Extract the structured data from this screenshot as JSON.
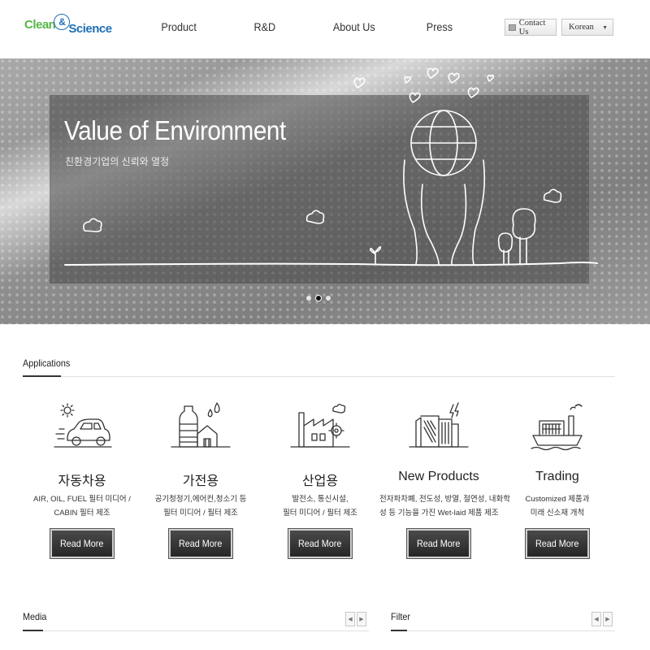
{
  "header": {
    "logo": {
      "part1": "Clean",
      "amp": "&",
      "part2": "Science"
    },
    "nav": [
      {
        "label": "Product"
      },
      {
        "label": "R&D"
      },
      {
        "label": "About Us"
      },
      {
        "label": "Press"
      }
    ],
    "contact_label": "Contact Us",
    "language": "Korean"
  },
  "hero": {
    "title": "Value of Environment",
    "subtitle": "친환경기업의 신뢰와 열정",
    "slides": 3,
    "active_slide": 2
  },
  "applications": {
    "title": "Applications",
    "items": [
      {
        "title": "자동차용",
        "desc1": "AIR, OIL, FUEL 필터 미디어 /",
        "desc2": "CABIN 필터 제조",
        "button": "Read More",
        "icon": "car-icon"
      },
      {
        "title": "가전용",
        "desc1": "공기청정기,에어컨,청소기 등",
        "desc2": "필터 미디어 / 필터 제조",
        "button": "Read More",
        "icon": "appliance-icon"
      },
      {
        "title": "산업용",
        "desc1": "발전소, 통신시설,",
        "desc2": "필터 미디어 / 필터 제조",
        "button": "Read More",
        "icon": "factory-icon"
      },
      {
        "title": "New Products",
        "desc1": "전자파차폐, 전도성, 방열, 절연성, 내화학",
        "desc2": "성 등 기능을 가진 Wet-laid 제품 제조",
        "button": "Read More",
        "icon": "new-products-icon"
      },
      {
        "title": "Trading",
        "desc1": "Customized 제품과",
        "desc2": "미래 신소재 개척",
        "button": "Read More",
        "icon": "ship-icon"
      }
    ]
  },
  "media": {
    "title": "Media",
    "prev": "◀",
    "next": "▶"
  },
  "filter": {
    "title": "Filter",
    "prev": "◀",
    "next": "▶"
  }
}
